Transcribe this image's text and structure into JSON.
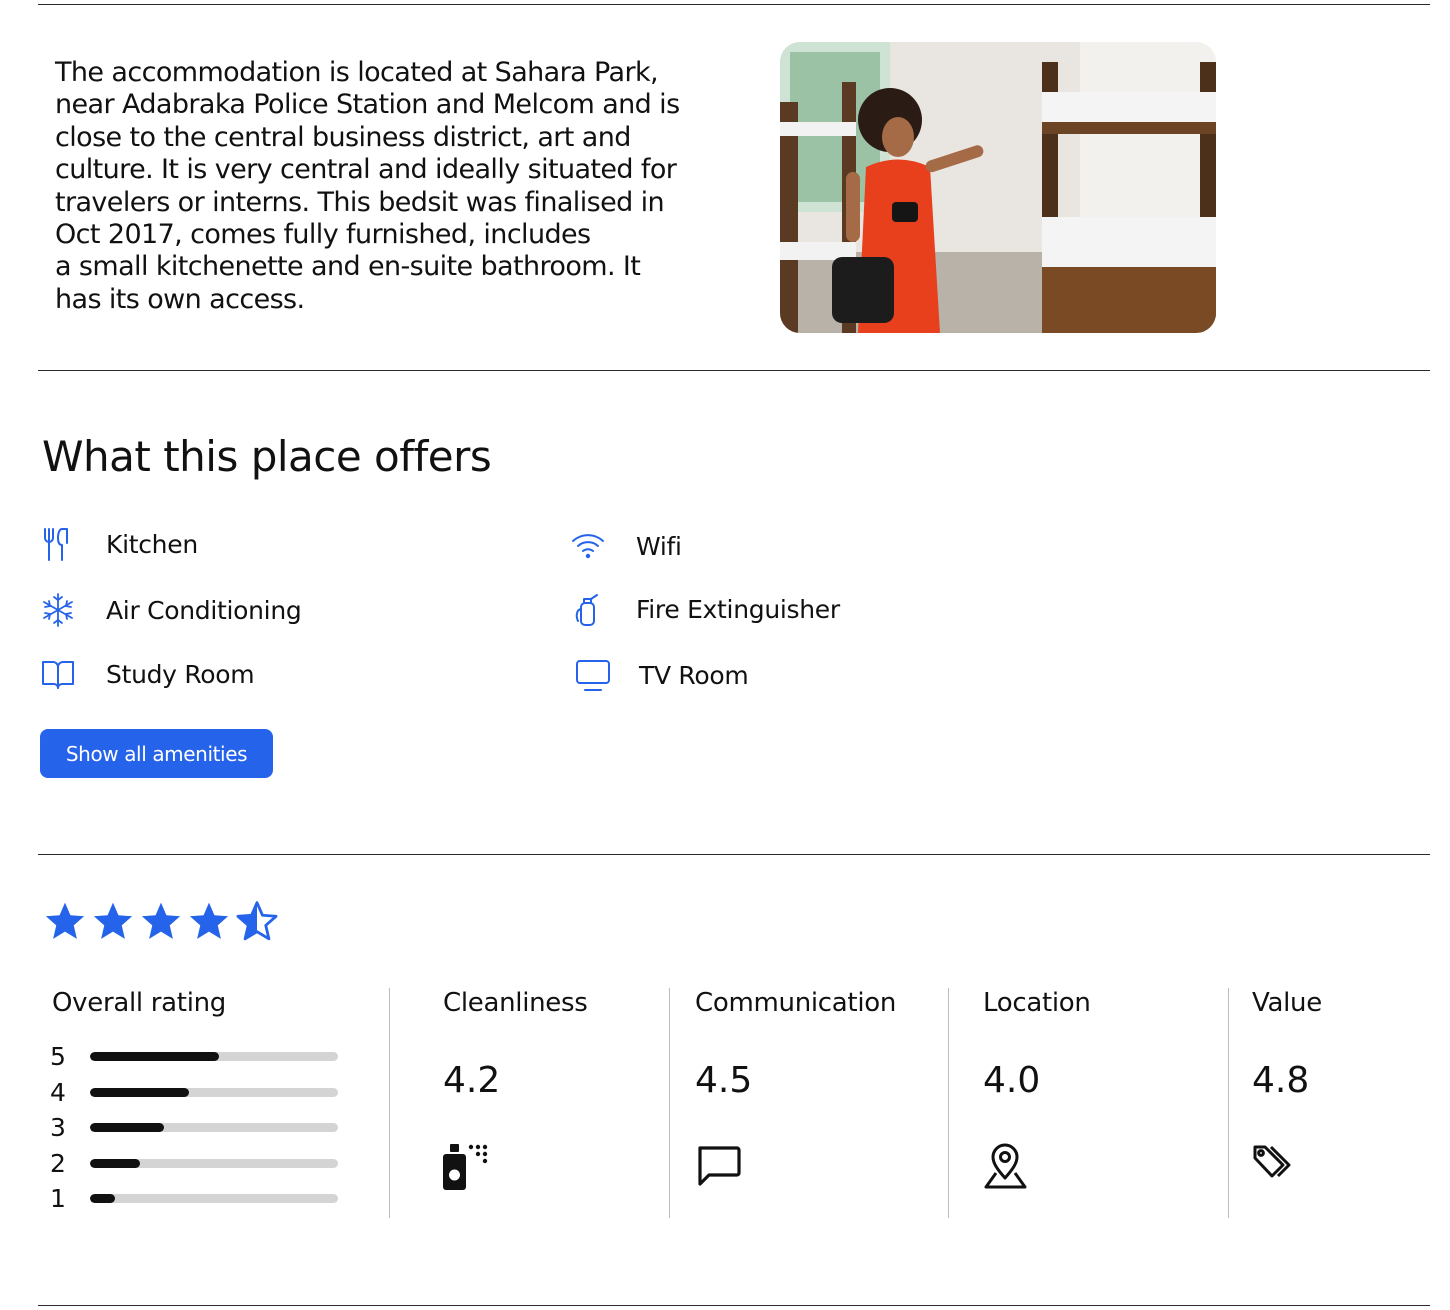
{
  "description": "The accommodation is located at Sahara Park,\nnear Adabraka Police Station and Melcom and is\nclose to the central business district, art and\nculture.  It is very central and ideally situated for\ntravelers or interns. This bedsit was finalised in\nOct 2017, comes fully furnished, includes\n a small kitchenette and en-suite bathroom. It\nhas its own access.",
  "offers": {
    "title": "What this place offers",
    "amenities": [
      {
        "label": "Kitchen",
        "icon": "utensils-icon"
      },
      {
        "label": "Wifi",
        "icon": "wifi-icon"
      },
      {
        "label": "Air Conditioning",
        "icon": "snowflake-icon"
      },
      {
        "label": "Fire Extinguisher",
        "icon": "fire-extinguisher-icon"
      },
      {
        "label": "Study Room",
        "icon": "book-open-icon"
      },
      {
        "label": "TV Room",
        "icon": "tv-icon"
      }
    ],
    "show_all_label": "Show all amenities"
  },
  "rating": {
    "stars": 4.5,
    "overall_label": "Overall rating",
    "distribution": [
      {
        "star": "5",
        "fraction": 0.52
      },
      {
        "star": "4",
        "fraction": 0.4
      },
      {
        "star": "3",
        "fraction": 0.3
      },
      {
        "star": "2",
        "fraction": 0.2
      },
      {
        "star": "1",
        "fraction": 0.1
      }
    ],
    "categories": [
      {
        "label": "Cleanliness",
        "score": "4.2",
        "icon": "spray-bottle-icon"
      },
      {
        "label": "Communication",
        "score": "4.5",
        "icon": "chat-bubble-icon"
      },
      {
        "label": "Location",
        "score": "4.0",
        "icon": "map-pin-icon"
      },
      {
        "label": "Value",
        "score": "4.8",
        "icon": "price-tag-icon"
      }
    ]
  },
  "colors": {
    "accent": "#2563eb",
    "bar_fill": "#111111",
    "bar_track": "#d4d4d4"
  }
}
